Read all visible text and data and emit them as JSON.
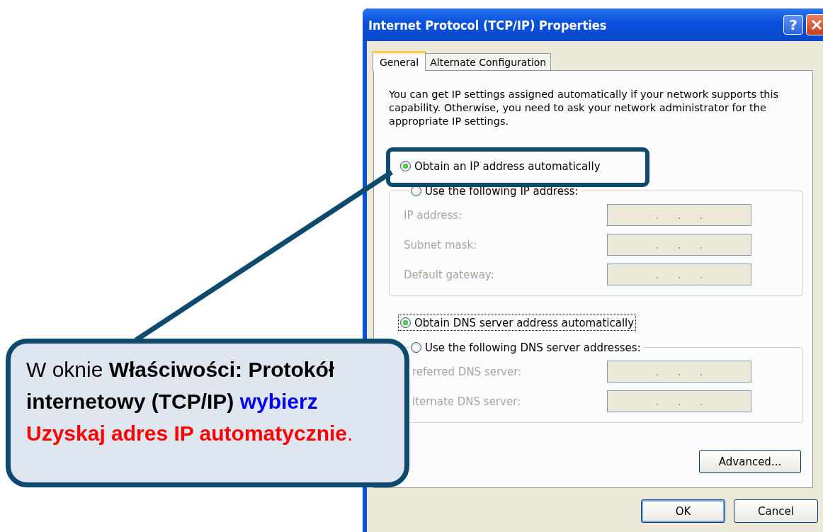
{
  "dialog": {
    "title": "Internet Protocol (TCP/IP) Properties",
    "help_glyph": "?",
    "tabs": [
      {
        "label": "General",
        "selected": true
      },
      {
        "label": "Alternate Configuration",
        "selected": false
      }
    ],
    "intro": "You can get IP settings assigned automatically if your network supports this capability. Otherwise, you need to ask your network administrator for the appropriate IP settings.",
    "ip_options": [
      {
        "label": "Obtain an IP address automatically",
        "selected": true,
        "focused": false
      },
      {
        "label": "Use the following IP address:",
        "selected": false,
        "focused": false
      }
    ],
    "ip_fields": [
      {
        "label": "IP address:",
        "disabled": true
      },
      {
        "label": "Subnet mask:",
        "disabled": true
      },
      {
        "label": "Default gateway:",
        "disabled": true
      }
    ],
    "dns_options": [
      {
        "label": "Obtain DNS server address automatically",
        "selected": true,
        "focused": true
      },
      {
        "label": "Use the following DNS server addresses:",
        "selected": false,
        "focused": false
      }
    ],
    "dns_fields": [
      {
        "label": "referred DNS server:",
        "disabled": true
      },
      {
        "label": "lternate DNS server:",
        "disabled": true
      }
    ],
    "advanced_button": "Advanced...",
    "buttons": [
      {
        "label": "OK",
        "default": true
      },
      {
        "label": "Cancel",
        "default": false
      }
    ]
  },
  "callout": {
    "segments": [
      {
        "text": "W oknie ",
        "kind": "plain"
      },
      {
        "text": "Właściwości: Protokół internetowy (TCP/IP) ",
        "kind": "bold"
      },
      {
        "text": "wybierz ",
        "kind": "blue"
      },
      {
        "text": "Uzyskaj adres IP automatycznie",
        "kind": "red"
      },
      {
        "text": ".",
        "kind": "red-plain"
      }
    ]
  }
}
